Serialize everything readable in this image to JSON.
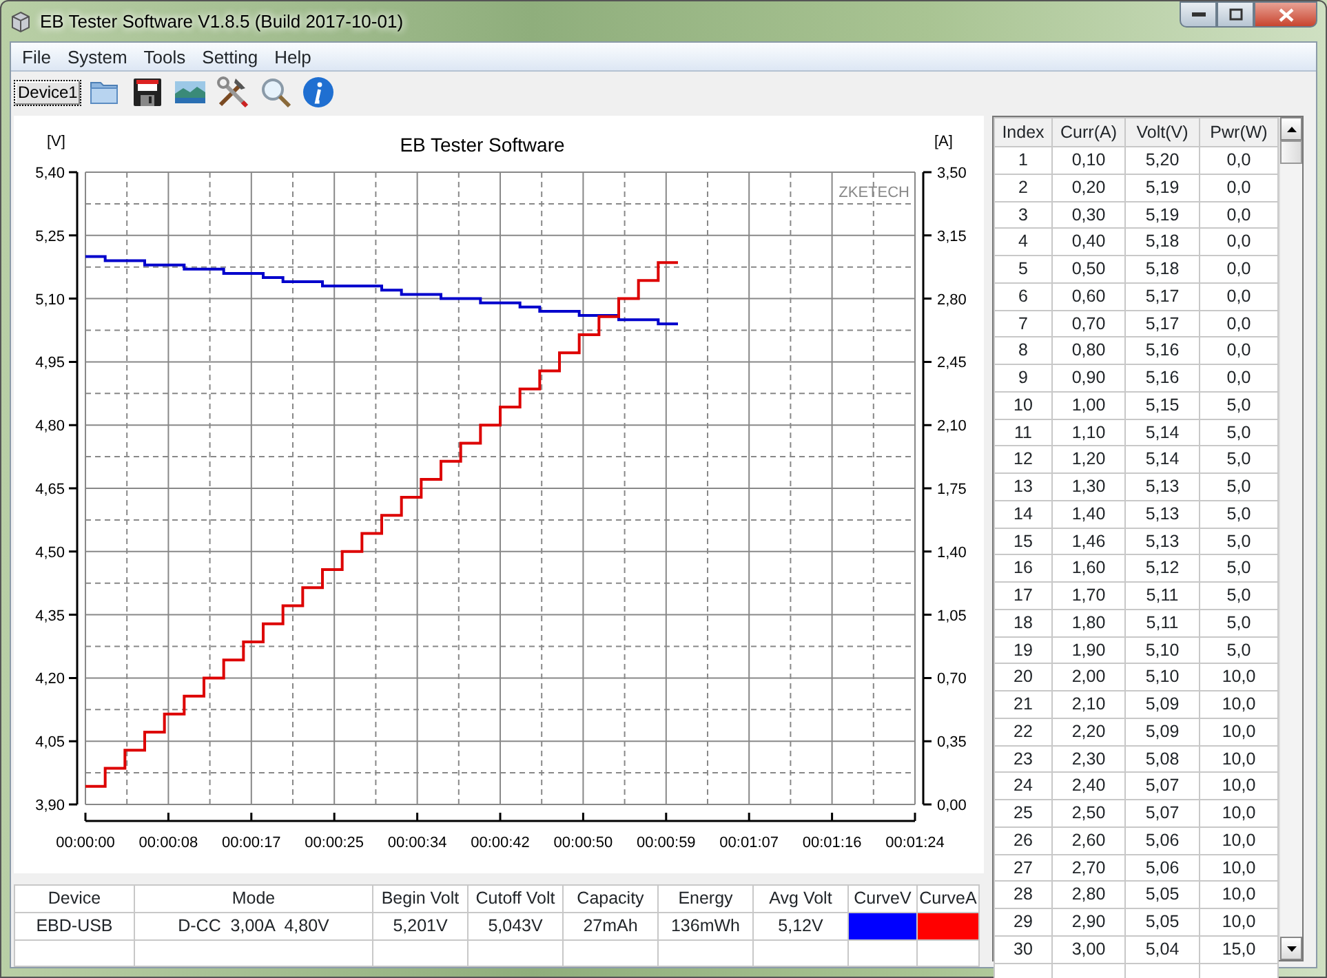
{
  "window": {
    "title": "EB Tester Software V1.8.5 (Build 2017-10-01)"
  },
  "menu": [
    "File",
    "System",
    "Tools",
    "Setting",
    "Help"
  ],
  "toolbar": {
    "device_tab": "Device1",
    "tools": [
      {
        "kind": "folder"
      },
      {
        "kind": "save"
      },
      {
        "kind": "picture"
      },
      {
        "kind": "tools"
      },
      {
        "kind": "search"
      },
      {
        "kind": "info"
      }
    ]
  },
  "chart": {
    "chart_data": {
      "type": "line",
      "title": "EB Tester Software",
      "ylabel": "[V]",
      "y2label": "[A]",
      "annotations": [
        {
          "text": "ZKETECH"
        }
      ],
      "grid": true,
      "x": [
        0,
        2,
        2,
        4,
        4,
        6,
        6,
        8,
        8,
        10,
        10,
        12,
        12,
        14,
        14,
        16,
        16,
        18,
        18,
        20,
        20,
        22,
        22,
        24,
        24,
        26,
        26,
        28,
        28,
        30,
        30,
        32,
        32,
        34,
        34,
        36,
        36,
        38,
        38,
        40,
        40,
        42,
        42,
        44,
        44,
        46,
        46,
        48,
        48,
        50,
        50,
        52,
        52,
        54,
        54,
        56,
        56,
        58,
        58,
        60
      ],
      "xlim": [
        0,
        84
      ],
      "xticks": [
        {
          "value": 0,
          "label": "00:00:00"
        },
        {
          "value": 8.4,
          "label": "00:00:08"
        },
        {
          "value": 16.8,
          "label": "00:00:17"
        },
        {
          "value": 25.2,
          "label": "00:00:25"
        },
        {
          "value": 33.6,
          "label": "00:00:34"
        },
        {
          "value": 42,
          "label": "00:00:42"
        },
        {
          "value": 50.4,
          "label": "00:00:50"
        },
        {
          "value": 58.8,
          "label": "00:00:59"
        },
        {
          "value": 67.2,
          "label": "00:01:07"
        },
        {
          "value": 75.6,
          "label": "00:01:16"
        },
        {
          "value": 84,
          "label": "00:01:24"
        }
      ],
      "ylim": [
        3.9,
        5.4
      ],
      "yticks": [
        {
          "value": 3.9,
          "label": "3,90"
        },
        {
          "value": 4.05,
          "label": "4,05"
        },
        {
          "value": 4.2,
          "label": "4,20"
        },
        {
          "value": 4.35,
          "label": "4,35"
        },
        {
          "value": 4.5,
          "label": "4,50"
        },
        {
          "value": 4.65,
          "label": "4,65"
        },
        {
          "value": 4.8,
          "label": "4,80"
        },
        {
          "value": 4.95,
          "label": "4,95"
        },
        {
          "value": 5.1,
          "label": "5,10"
        },
        {
          "value": 5.25,
          "label": "5,25"
        },
        {
          "value": 5.4,
          "label": "5,40"
        }
      ],
      "y2lim": [
        0,
        3.5
      ],
      "y2ticks": [
        {
          "value": 0,
          "label": "0,00"
        },
        {
          "value": 0.35,
          "label": "0,35"
        },
        {
          "value": 0.7,
          "label": "0,70"
        },
        {
          "value": 1.05,
          "label": "1,05"
        },
        {
          "value": 1.4,
          "label": "1,40"
        },
        {
          "value": 1.75,
          "label": "1,75"
        },
        {
          "value": 2.1,
          "label": "2,10"
        },
        {
          "value": 2.45,
          "label": "2,45"
        },
        {
          "value": 2.8,
          "label": "2,80"
        },
        {
          "value": 3.15,
          "label": "3,15"
        },
        {
          "value": 3.5,
          "label": "3,50"
        }
      ],
      "series": [
        {
          "color": "#0000cc",
          "values": [
            5.2,
            5.2,
            5.19,
            5.19,
            5.19,
            5.19,
            5.18,
            5.18,
            5.18,
            5.18,
            5.17,
            5.17,
            5.17,
            5.17,
            5.16,
            5.16,
            5.16,
            5.16,
            5.15,
            5.15,
            5.14,
            5.14,
            5.14,
            5.14,
            5.13,
            5.13,
            5.13,
            5.13,
            5.13,
            5.13,
            5.12,
            5.12,
            5.11,
            5.11,
            5.11,
            5.11,
            5.1,
            5.1,
            5.1,
            5.1,
            5.09,
            5.09,
            5.09,
            5.09,
            5.08,
            5.08,
            5.07,
            5.07,
            5.07,
            5.07,
            5.06,
            5.06,
            5.06,
            5.06,
            5.05,
            5.05,
            5.05,
            5.05,
            5.04,
            5.04
          ]
        },
        {
          "axis": "y2",
          "color": "#dd0000",
          "values": [
            0.1,
            0.1,
            0.2,
            0.2,
            0.3,
            0.3,
            0.4,
            0.4,
            0.5,
            0.5,
            0.6,
            0.6,
            0.7,
            0.7,
            0.8,
            0.8,
            0.9,
            0.9,
            1.0,
            1.0,
            1.1,
            1.1,
            1.2,
            1.2,
            1.3,
            1.3,
            1.4,
            1.4,
            1.5,
            1.5,
            1.6,
            1.6,
            1.7,
            1.7,
            1.8,
            1.8,
            1.9,
            1.9,
            2.0,
            2.0,
            2.1,
            2.1,
            2.2,
            2.2,
            2.3,
            2.3,
            2.4,
            2.4,
            2.5,
            2.5,
            2.6,
            2.6,
            2.7,
            2.7,
            2.8,
            2.8,
            2.9,
            2.9,
            3.0,
            3.0
          ]
        }
      ]
    }
  },
  "summary": {
    "columns": [
      "Device",
      "Mode",
      "Begin Volt",
      "Cutoff Volt",
      "Capacity",
      "Energy",
      "Avg Volt",
      "CurveV",
      "CurveA"
    ],
    "row": {
      "cells": [
        "EBD-USB",
        "D-CC  3,00A  4,80V",
        "5,201V",
        "5,043V",
        "27mAh",
        "136mWh",
        "5,12V"
      ],
      "curves": [
        {
          "color": "#0000ff"
        },
        {
          "color": "#ff0000"
        }
      ]
    }
  },
  "readings": {
    "columns": [
      "Index",
      "Curr(A)",
      "Volt(V)",
      "Pwr(W)"
    ],
    "rows": [
      [
        "1",
        "0,10",
        "5,20",
        "0,0"
      ],
      [
        "2",
        "0,20",
        "5,19",
        "0,0"
      ],
      [
        "3",
        "0,30",
        "5,19",
        "0,0"
      ],
      [
        "4",
        "0,40",
        "5,18",
        "0,0"
      ],
      [
        "5",
        "0,50",
        "5,18",
        "0,0"
      ],
      [
        "6",
        "0,60",
        "5,17",
        "0,0"
      ],
      [
        "7",
        "0,70",
        "5,17",
        "0,0"
      ],
      [
        "8",
        "0,80",
        "5,16",
        "0,0"
      ],
      [
        "9",
        "0,90",
        "5,16",
        "0,0"
      ],
      [
        "10",
        "1,00",
        "5,15",
        "5,0"
      ],
      [
        "11",
        "1,10",
        "5,14",
        "5,0"
      ],
      [
        "12",
        "1,20",
        "5,14",
        "5,0"
      ],
      [
        "13",
        "1,30",
        "5,13",
        "5,0"
      ],
      [
        "14",
        "1,40",
        "5,13",
        "5,0"
      ],
      [
        "15",
        "1,46",
        "5,13",
        "5,0"
      ],
      [
        "16",
        "1,60",
        "5,12",
        "5,0"
      ],
      [
        "17",
        "1,70",
        "5,11",
        "5,0"
      ],
      [
        "18",
        "1,80",
        "5,11",
        "5,0"
      ],
      [
        "19",
        "1,90",
        "5,10",
        "5,0"
      ],
      [
        "20",
        "2,00",
        "5,10",
        "10,0"
      ],
      [
        "21",
        "2,10",
        "5,09",
        "10,0"
      ],
      [
        "22",
        "2,20",
        "5,09",
        "10,0"
      ],
      [
        "23",
        "2,30",
        "5,08",
        "10,0"
      ],
      [
        "24",
        "2,40",
        "5,07",
        "10,0"
      ],
      [
        "25",
        "2,50",
        "5,07",
        "10,0"
      ],
      [
        "26",
        "2,60",
        "5,06",
        "10,0"
      ],
      [
        "27",
        "2,70",
        "5,06",
        "10,0"
      ],
      [
        "28",
        "2,80",
        "5,05",
        "10,0"
      ],
      [
        "29",
        "2,90",
        "5,05",
        "10,0"
      ],
      [
        "30",
        "3,00",
        "5,04",
        "15,0"
      ]
    ]
  }
}
